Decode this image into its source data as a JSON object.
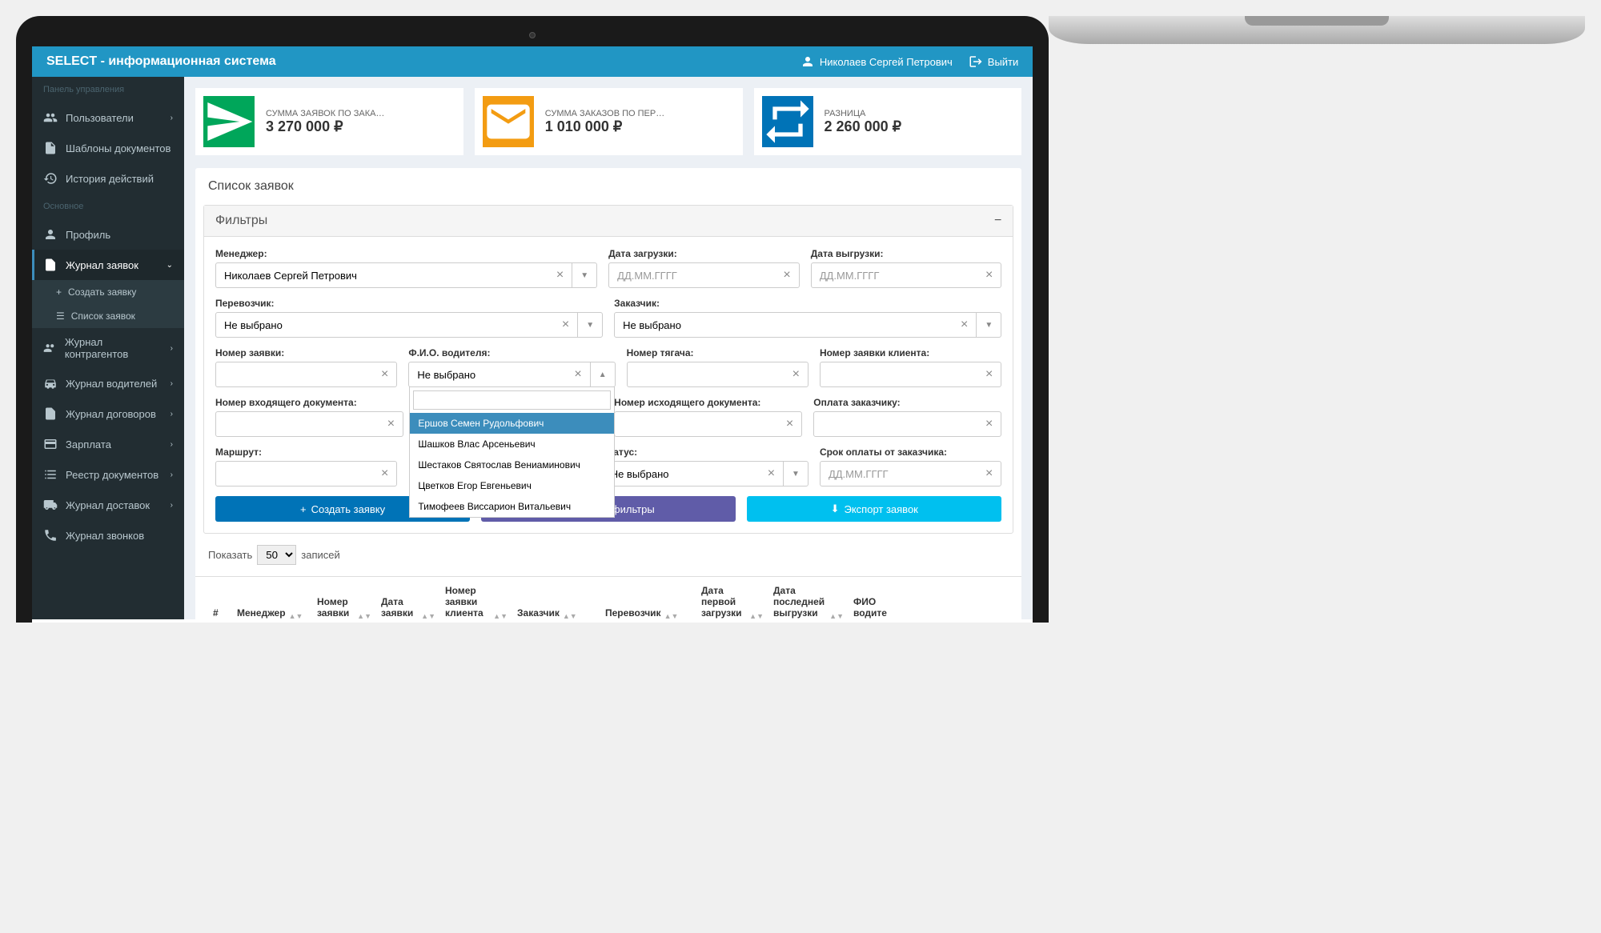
{
  "header": {
    "title": "SELECT - информационная система",
    "user": "Николаев Сергей Петрович",
    "logout": "Выйти"
  },
  "sidebar": {
    "section1": "Панель управления",
    "users": "Пользователи",
    "templates": "Шаблоны документов",
    "history": "История действий",
    "section2": "Основное",
    "profile": "Профиль",
    "journal": "Журнал заявок",
    "create": "Создать заявку",
    "list": "Список заявок",
    "contragents": "Журнал контрагентов",
    "drivers": "Журнал водителей",
    "contracts": "Журнал договоров",
    "salary": "Зарплата",
    "registry": "Реестр документов",
    "delivery": "Журнал доставок",
    "calls": "Журнал звонков"
  },
  "stats": {
    "s1_label": "СУММА ЗАЯВОК ПО ЗАКАЗ...",
    "s1_value": "3 270 000 ₽",
    "s2_label": "СУММА ЗАКАЗОВ ПО ПЕРЕ...",
    "s2_value": "1 010 000 ₽",
    "s3_label": "РАЗНИЦА",
    "s3_value": "2 260 000 ₽"
  },
  "panel": {
    "title": "Список заявок",
    "filters_title": "Фильтры"
  },
  "filters": {
    "manager_label": "Менеджер:",
    "manager_value": "Николаев Сергей Петрович",
    "load_date_label": "Дата загрузки:",
    "unload_date_label": "Дата выгрузки:",
    "date_placeholder": "ДД.ММ.ГГГГ",
    "carrier_label": "Перевозчик:",
    "customer_label": "Заказчик:",
    "not_selected": "Не выбрано",
    "request_num_label": "Номер заявки:",
    "driver_label": "Ф.И.О. водителя:",
    "truck_label": "Номер тягача:",
    "client_req_label": "Номер заявки клиента:",
    "incoming_label": "Номер входящего документа:",
    "outgoing_label": "Номер исходящего документа:",
    "payment_label": "Оплата заказчику:",
    "route_label": "Маршрут:",
    "status_label": "Статус:",
    "deadline_label": "Срок оплаты от заказчика:"
  },
  "dropdown": {
    "opt1": "Ершов Семен Рудольфович",
    "opt2": "Шашков Влас Арсеньевич",
    "opt3": "Шестаков Святослав Вениаминович",
    "opt4": "Цветков Егор Евгеньевич",
    "opt5": "Тимофеев Виссарион Витальевич"
  },
  "buttons": {
    "create": "Создать заявку",
    "reset": "Сбросить фильтры",
    "export": "Экспорт заявок"
  },
  "table": {
    "show": "Показать",
    "entries": "записей",
    "page_size": "50",
    "col_num": "#",
    "col_manager": "Менеджер",
    "col_req_num": "Номер заявки",
    "col_req_date": "Дата заявки",
    "col_client_num": "Номер заявки клиента",
    "col_customer": "Заказчик",
    "col_carrier": "Перевозчик",
    "col_first_load": "Дата первой загрузки",
    "col_last_unload": "Дата последней выгрузки",
    "col_driver": "ФИО водите"
  }
}
